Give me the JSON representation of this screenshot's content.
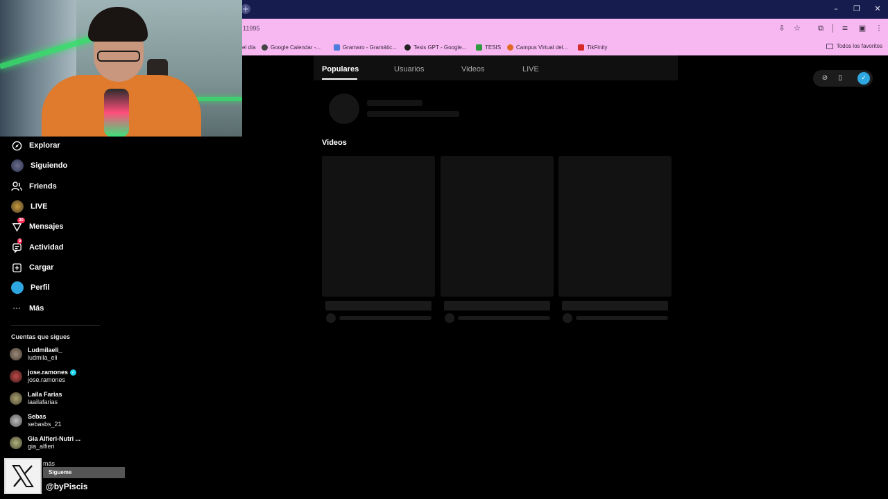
{
  "browser": {
    "url": "11995",
    "bookmarks": [
      {
        "label": "el día",
        "color": "#777777"
      },
      {
        "label": "Google Calendar -...",
        "color": "#444444"
      },
      {
        "label": "Gramaro - Gramátic...",
        "color": "#4c7ddc"
      },
      {
        "label": "Tesis GPT - Google...",
        "color": "#222222"
      },
      {
        "label": "TESIS",
        "color": "#2e9b3e"
      },
      {
        "label": "Campus Virtual del...",
        "color": "#e06a1f"
      },
      {
        "label": "TikFinity",
        "color": "#d92a2a"
      }
    ],
    "favorites_label": "Todos los favoritos",
    "icons": [
      "new-tab-icon",
      "minimize-icon",
      "restore-icon",
      "close-icon",
      "install-icon",
      "star-icon",
      "extensions-icon",
      "media-icon",
      "profile-icon",
      "menu-icon"
    ]
  },
  "nav": {
    "items": [
      {
        "label": "Explorar",
        "icon": "compass-icon"
      },
      {
        "label": "Siguiendo",
        "icon": "following-avatar"
      },
      {
        "label": "Friends",
        "icon": "friends-icon"
      },
      {
        "label": "LIVE",
        "icon": "live-avatar"
      },
      {
        "label": "Mensajes",
        "icon": "messages-icon",
        "badge": "30"
      },
      {
        "label": "Actividad",
        "icon": "activity-icon",
        "badge": "5"
      },
      {
        "label": "Cargar",
        "icon": "upload-icon"
      },
      {
        "label": "Perfil",
        "icon": "profile-avatar"
      },
      {
        "label": "Más",
        "icon": "more-icon"
      }
    ]
  },
  "following": {
    "title": "Cuentas que sigues",
    "accounts": [
      {
        "name": "Ludmilaeli_",
        "user": "ludmila_eli",
        "verified": false
      },
      {
        "name": "jose.ramones",
        "user": "jose.ramones",
        "verified": true
      },
      {
        "name": "Laila Farias",
        "user": "laailafarias",
        "verified": false
      },
      {
        "name": "Sebas",
        "user": "sebasbs_21",
        "verified": false
      },
      {
        "name": "Gia Alfieri-Nutri ...",
        "user": "gia_alfieri",
        "verified": false
      }
    ],
    "more_label": "más"
  },
  "overlay": {
    "follow_label": "Sigueme",
    "handle": "@byPiscis"
  },
  "main": {
    "tabs": [
      {
        "label": "Populares",
        "active": true
      },
      {
        "label": "Usuarios",
        "active": false
      },
      {
        "label": "Videos",
        "active": false
      },
      {
        "label": "LIVE",
        "active": false
      }
    ],
    "videos_title": "Videos"
  },
  "colors": {
    "tabbar": "#171c4f",
    "toolbar": "#f7b7f1",
    "background": "#000000",
    "badge": "#fe2c55",
    "verified": "#20d5ec"
  }
}
